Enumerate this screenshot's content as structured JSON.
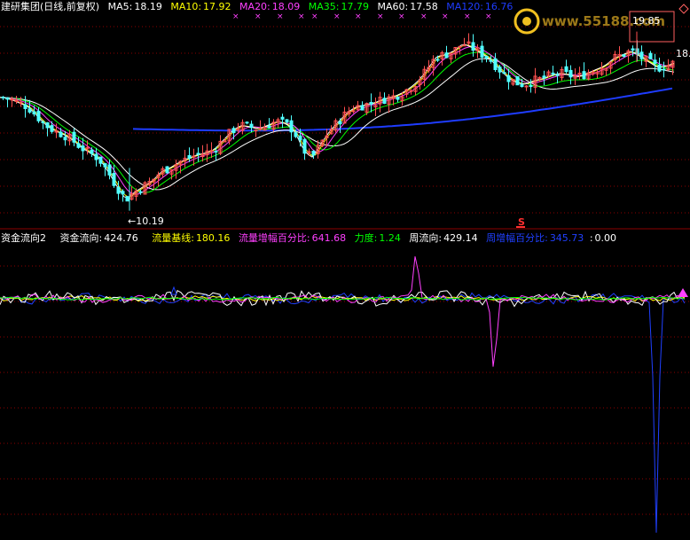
{
  "colors": {
    "background": "#000000",
    "grid": "#8b0000",
    "up_candle": "#ff5050",
    "down_candle": "#50ffff",
    "ma5": "#ffffff",
    "ma10": "#ffff00",
    "ma20": "#ff40ff",
    "ma35": "#00ff00",
    "ma60": "#ffffff",
    "ma120": "#1e3cff",
    "fund_flow": "#ffffff",
    "flow_base": "#ffff00",
    "flow_pct": "#ff40ff",
    "force": "#00ff00",
    "weekly_flow": "#ffffff",
    "weekly_pct": "#2040ff"
  },
  "header": {
    "stock_name": "建研集团(日线,前复权)",
    "ma": [
      {
        "label": "MA5:",
        "value": "18.19",
        "color": "#ffffff"
      },
      {
        "label": "MA10:",
        "value": "17.92",
        "color": "#ffff00"
      },
      {
        "label": "MA20:",
        "value": "18.09",
        "color": "#ff40ff"
      },
      {
        "label": "MA35:",
        "value": "17.79",
        "color": "#00ff00"
      },
      {
        "label": "MA60:",
        "value": "17.58",
        "color": "#ffffff"
      },
      {
        "label": "MA120:",
        "value": "16.76",
        "color": "#1e3cff"
      }
    ]
  },
  "watermark": {
    "text": "www.55188.com"
  },
  "annotations": {
    "high_label": "19.85",
    "low_label": "←10.19",
    "right_price": "18.",
    "s_marker": "S"
  },
  "indicator_header": {
    "name": "资金流向2",
    "items": [
      {
        "label": "资金流向:",
        "value": "424.76",
        "color": "#ffffff"
      },
      {
        "label": "流量基线:",
        "value": "180.16",
        "color": "#ffff00"
      },
      {
        "label": "流量增幅百分比:",
        "value": "641.68",
        "color": "#ff40ff"
      },
      {
        "label": "力度:",
        "value": "1.24",
        "color": "#00ff00"
      },
      {
        "label": "周流向:",
        "value": "429.14",
        "color": "#ffffff"
      },
      {
        "label": "周增幅百分比:",
        "value": "345.73",
        "color": "#2040ff"
      },
      {
        "label": ":",
        "value": "0.00",
        "color": "#ffffff"
      }
    ]
  },
  "chart_data": [
    {
      "type": "candlestick",
      "ylim": [
        9.6,
        20.5
      ],
      "series": [
        {
          "name": "MA5",
          "values": [
            18.19
          ]
        },
        {
          "name": "MA10",
          "values": [
            17.92
          ]
        },
        {
          "name": "MA20",
          "values": [
            18.09
          ]
        },
        {
          "name": "MA35",
          "values": [
            17.79
          ]
        },
        {
          "name": "MA60",
          "values": [
            17.58
          ]
        },
        {
          "name": "MA120",
          "values": [
            16.76
          ]
        }
      ],
      "price_path": [
        [
          0,
          16.3
        ],
        [
          10,
          16.2
        ],
        [
          20,
          16.0
        ],
        [
          30,
          15.8
        ],
        [
          40,
          15.3
        ],
        [
          50,
          14.8
        ],
        [
          60,
          14.5
        ],
        [
          70,
          14.3
        ],
        [
          80,
          14.0
        ],
        [
          90,
          13.6
        ],
        [
          100,
          13.3
        ],
        [
          110,
          13.0
        ],
        [
          120,
          12.3
        ],
        [
          130,
          11.5
        ],
        [
          140,
          10.8
        ],
        [
          150,
          11.2
        ],
        [
          160,
          11.5
        ],
        [
          170,
          11.8
        ],
        [
          180,
          12.3
        ],
        [
          190,
          12.5
        ],
        [
          200,
          12.8
        ],
        [
          210,
          13.0
        ],
        [
          220,
          13.2
        ],
        [
          230,
          13.3
        ],
        [
          240,
          13.5
        ],
        [
          250,
          14.0
        ],
        [
          260,
          14.5
        ],
        [
          270,
          14.8
        ],
        [
          280,
          14.7
        ],
        [
          290,
          14.6
        ],
        [
          300,
          14.8
        ],
        [
          310,
          15.0
        ],
        [
          320,
          14.9
        ],
        [
          330,
          14.5
        ],
        [
          340,
          13.5
        ],
        [
          350,
          13.0
        ],
        [
          360,
          13.8
        ],
        [
          370,
          14.5
        ],
        [
          380,
          15.0
        ],
        [
          390,
          15.5
        ],
        [
          400,
          15.8
        ],
        [
          410,
          15.9
        ],
        [
          420,
          16.0
        ],
        [
          430,
          16.2
        ],
        [
          440,
          16.3
        ],
        [
          450,
          16.5
        ],
        [
          460,
          16.8
        ],
        [
          470,
          17.2
        ],
        [
          480,
          17.8
        ],
        [
          490,
          18.5
        ],
        [
          500,
          18.6
        ],
        [
          510,
          18.8
        ],
        [
          520,
          19.2
        ],
        [
          530,
          19.0
        ],
        [
          540,
          18.7
        ],
        [
          550,
          18.4
        ],
        [
          560,
          17.9
        ],
        [
          570,
          17.4
        ],
        [
          580,
          17.1
        ],
        [
          590,
          17.0
        ],
        [
          600,
          17.2
        ],
        [
          610,
          17.3
        ],
        [
          620,
          17.5
        ],
        [
          630,
          17.6
        ],
        [
          640,
          17.5
        ],
        [
          650,
          17.4
        ],
        [
          660,
          17.6
        ],
        [
          670,
          17.8
        ],
        [
          680,
          18.0
        ],
        [
          690,
          18.4
        ],
        [
          700,
          18.6
        ],
        [
          710,
          18.8
        ],
        [
          720,
          18.5
        ],
        [
          730,
          18.2
        ],
        [
          740,
          17.9
        ],
        [
          750,
          18.0
        ],
        [
          760,
          18.19
        ]
      ],
      "high": 19.85,
      "low": 10.19
    },
    {
      "type": "line",
      "ylim": [
        -3200,
        700
      ],
      "series": [
        {
          "name": "资金流向",
          "values": [
            424.76
          ]
        },
        {
          "name": "流量基线",
          "values": [
            180.16
          ]
        },
        {
          "name": "流量增幅百分比",
          "values": [
            641.68
          ]
        },
        {
          "name": "力度",
          "values": [
            1.24
          ]
        },
        {
          "name": "周流向",
          "values": [
            429.14
          ]
        },
        {
          "name": "周增幅百分比",
          "values": [
            345.73
          ]
        }
      ],
      "spikes": [
        {
          "x": 469,
          "value": 680,
          "series": "流量增幅百分比"
        },
        {
          "x": 557,
          "value": -1100,
          "series": "流量增幅百分比"
        },
        {
          "x": 740,
          "value": -3150,
          "series": "周增幅百分比"
        }
      ]
    }
  ]
}
